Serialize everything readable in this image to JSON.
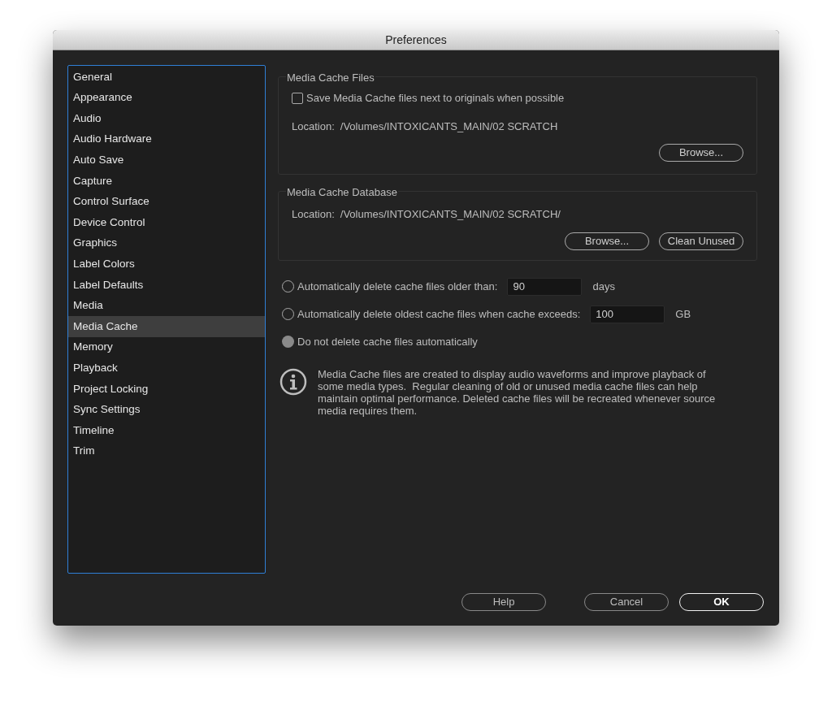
{
  "window": {
    "title": "Preferences"
  },
  "sidebar": {
    "items": [
      {
        "label": "General",
        "selected": false
      },
      {
        "label": "Appearance",
        "selected": false
      },
      {
        "label": "Audio",
        "selected": false
      },
      {
        "label": "Audio Hardware",
        "selected": false
      },
      {
        "label": "Auto Save",
        "selected": false
      },
      {
        "label": "Capture",
        "selected": false
      },
      {
        "label": "Control Surface",
        "selected": false
      },
      {
        "label": "Device Control",
        "selected": false
      },
      {
        "label": "Graphics",
        "selected": false
      },
      {
        "label": "Label Colors",
        "selected": false
      },
      {
        "label": "Label Defaults",
        "selected": false
      },
      {
        "label": "Media",
        "selected": false
      },
      {
        "label": "Media Cache",
        "selected": true
      },
      {
        "label": "Memory",
        "selected": false
      },
      {
        "label": "Playback",
        "selected": false
      },
      {
        "label": "Project Locking",
        "selected": false
      },
      {
        "label": "Sync Settings",
        "selected": false
      },
      {
        "label": "Timeline",
        "selected": false
      },
      {
        "label": "Trim",
        "selected": false
      }
    ]
  },
  "media_cache_files": {
    "title": "Media Cache Files",
    "checkbox": {
      "label": "Save Media Cache files next to originals when possible",
      "checked": false
    },
    "location_label": "Location:",
    "location": "/Volumes/INTOXICANTS_MAIN/02 SCRATCH",
    "buttons": [
      "Browse..."
    ]
  },
  "media_cache_database": {
    "title": "Media Cache Database",
    "location_label": "Location:",
    "location": "/Volumes/INTOXICANTS_MAIN/02 SCRATCH/",
    "buttons": [
      "Browse...",
      "Clean Unused"
    ]
  },
  "delete_options": [
    {
      "label": "Automatically delete cache files older than:",
      "selected": false,
      "value": "90",
      "unit": "days"
    },
    {
      "label": "Automatically delete oldest cache files when cache exceeds:",
      "selected": false,
      "value": "100",
      "unit": "GB"
    },
    {
      "label": "Do not delete cache files automatically",
      "selected": true
    }
  ],
  "info": "Media Cache files are created to display audio waveforms and improve playback of some media types.  Regular cleaning of old or unused media cache files can help maintain optimal performance. Deleted cache files will be recreated whenever source media requires them.",
  "footer_buttons": [
    {
      "label": "Help",
      "default": false
    },
    {
      "label": "Cancel",
      "default": false
    },
    {
      "label": "OK",
      "default": true
    }
  ]
}
